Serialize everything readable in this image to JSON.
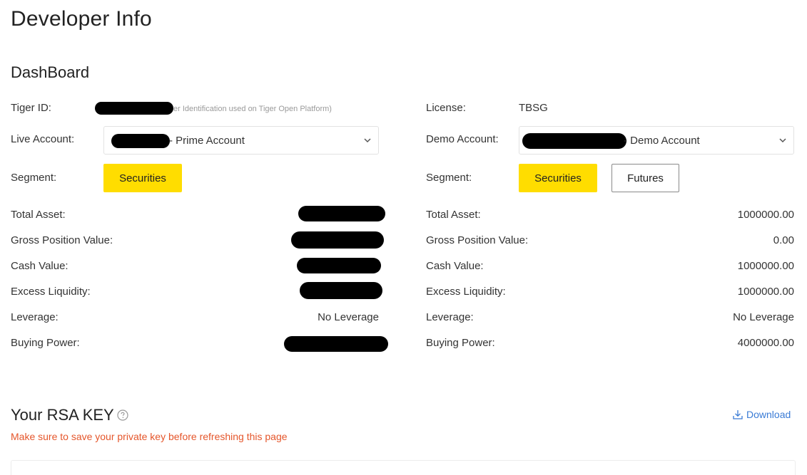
{
  "page": {
    "title": "Developer Info",
    "section_title": "DashBoard"
  },
  "live": {
    "tiger_id_label": "Tiger ID:",
    "tiger_id_hint": "er Identification used on Tiger Open Platform)",
    "account_label": "Live Account:",
    "account_value": "- Prime Account",
    "segment_label": "Segment:",
    "segments": [
      "Securities"
    ],
    "metrics": [
      {
        "label": "Total Asset:",
        "value": ""
      },
      {
        "label": "Gross Position Value:",
        "value": ""
      },
      {
        "label": "Cash Value:",
        "value": ""
      },
      {
        "label": "Excess Liquidity:",
        "value": ""
      },
      {
        "label": "Leverage:",
        "value": "No Leverage"
      },
      {
        "label": "Buying Power:",
        "value": ""
      }
    ]
  },
  "demo": {
    "license_label": "License:",
    "license_value": "TBSG",
    "account_label": "Demo Account:",
    "account_value": "- Demo Account",
    "segment_label": "Segment:",
    "segments": [
      "Securities",
      "Futures"
    ],
    "metrics": [
      {
        "label": "Total Asset:",
        "value": "1000000.00"
      },
      {
        "label": "Gross Position Value:",
        "value": "0.00"
      },
      {
        "label": "Cash Value:",
        "value": "1000000.00"
      },
      {
        "label": "Excess Liquidity:",
        "value": "1000000.00"
      },
      {
        "label": "Leverage:",
        "value": "No Leverage"
      },
      {
        "label": "Buying Power:",
        "value": "4000000.00"
      }
    ]
  },
  "rsa": {
    "title": "Your RSA KEY",
    "warning": "Make sure to save your private key before refreshing this page",
    "download_label": "Download"
  },
  "colors": {
    "accent_yellow": "#FFDD00",
    "warning": "#E5562B",
    "link": "#3A7BD5"
  },
  "icons": {
    "help": "question-circle-icon",
    "download": "download-icon",
    "dropdown": "chevron-down-icon"
  }
}
